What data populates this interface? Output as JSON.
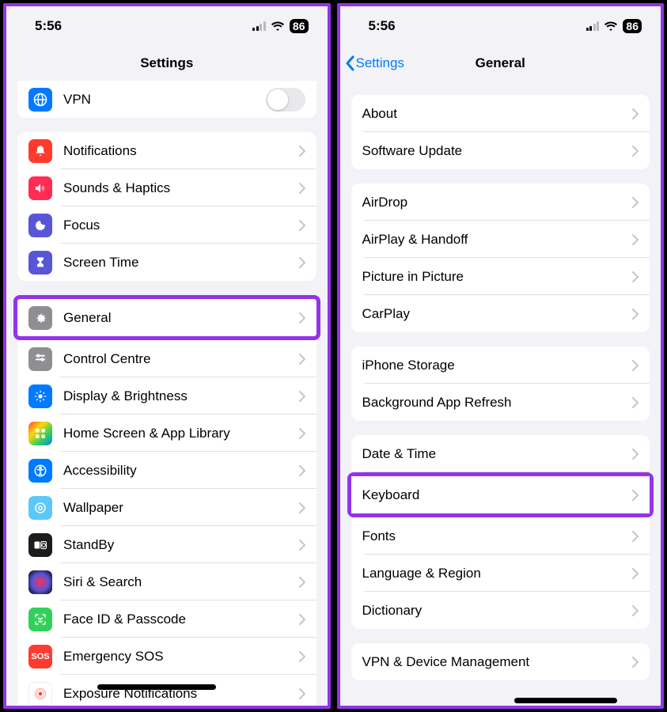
{
  "left": {
    "status": {
      "time": "5:56",
      "battery": "86"
    },
    "nav": {
      "title": "Settings"
    },
    "group0": {
      "vpn": "VPN"
    },
    "group1": {
      "notifications": "Notifications",
      "sounds": "Sounds & Haptics",
      "focus": "Focus",
      "screentime": "Screen Time"
    },
    "group2": {
      "general": "General",
      "controlcentre": "Control Centre",
      "display": "Display & Brightness",
      "homescreen": "Home Screen & App Library",
      "accessibility": "Accessibility",
      "wallpaper": "Wallpaper",
      "standby": "StandBy",
      "siri": "Siri & Search",
      "faceid": "Face ID & Passcode",
      "sos": "Emergency SOS",
      "exposure": "Exposure Notifications"
    }
  },
  "right": {
    "status": {
      "time": "5:56",
      "battery": "86"
    },
    "nav": {
      "back": "Settings",
      "title": "General"
    },
    "group1": {
      "about": "About",
      "software": "Software Update"
    },
    "group2": {
      "airdrop": "AirDrop",
      "airplay": "AirPlay & Handoff",
      "pip": "Picture in Picture",
      "carplay": "CarPlay"
    },
    "group3": {
      "storage": "iPhone Storage",
      "bgrefresh": "Background App Refresh"
    },
    "group4": {
      "datetime": "Date & Time",
      "keyboard": "Keyboard",
      "fonts": "Fonts",
      "language": "Language & Region",
      "dictionary": "Dictionary"
    },
    "group5": {
      "vpndm": "VPN & Device Management"
    }
  }
}
